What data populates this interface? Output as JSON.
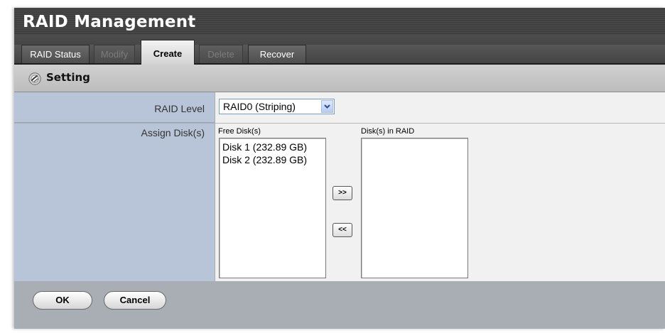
{
  "title": "RAID Management",
  "tabs": [
    {
      "label": "RAID Status",
      "state": "normal"
    },
    {
      "label": "Modify",
      "state": "disabled"
    },
    {
      "label": "Create",
      "state": "active"
    },
    {
      "label": "Delete",
      "state": "disabled"
    },
    {
      "label": "Recover",
      "state": "normal"
    }
  ],
  "section": {
    "title": "Setting",
    "icon": "gear-icon"
  },
  "form": {
    "raid_level": {
      "label": "RAID Level",
      "value": "RAID0 (Striping)"
    },
    "assign": {
      "label": "Assign Disk(s)",
      "free_label": "Free Disk(s)",
      "in_raid_label": "Disk(s) in RAID",
      "free_disks": [
        "Disk 1 (232.89 GB)",
        "Disk 2 (232.89 GB)"
      ],
      "raid_disks": [],
      "add_label": ">>",
      "remove_label": "<<"
    }
  },
  "buttons": {
    "ok": "OK",
    "cancel": "Cancel"
  },
  "colors": {
    "label_bg": "#b8c4d7",
    "panel_bg": "#a9adb4",
    "value_bg": "#f1f1f1",
    "header_dark": "#3f3f3f"
  }
}
